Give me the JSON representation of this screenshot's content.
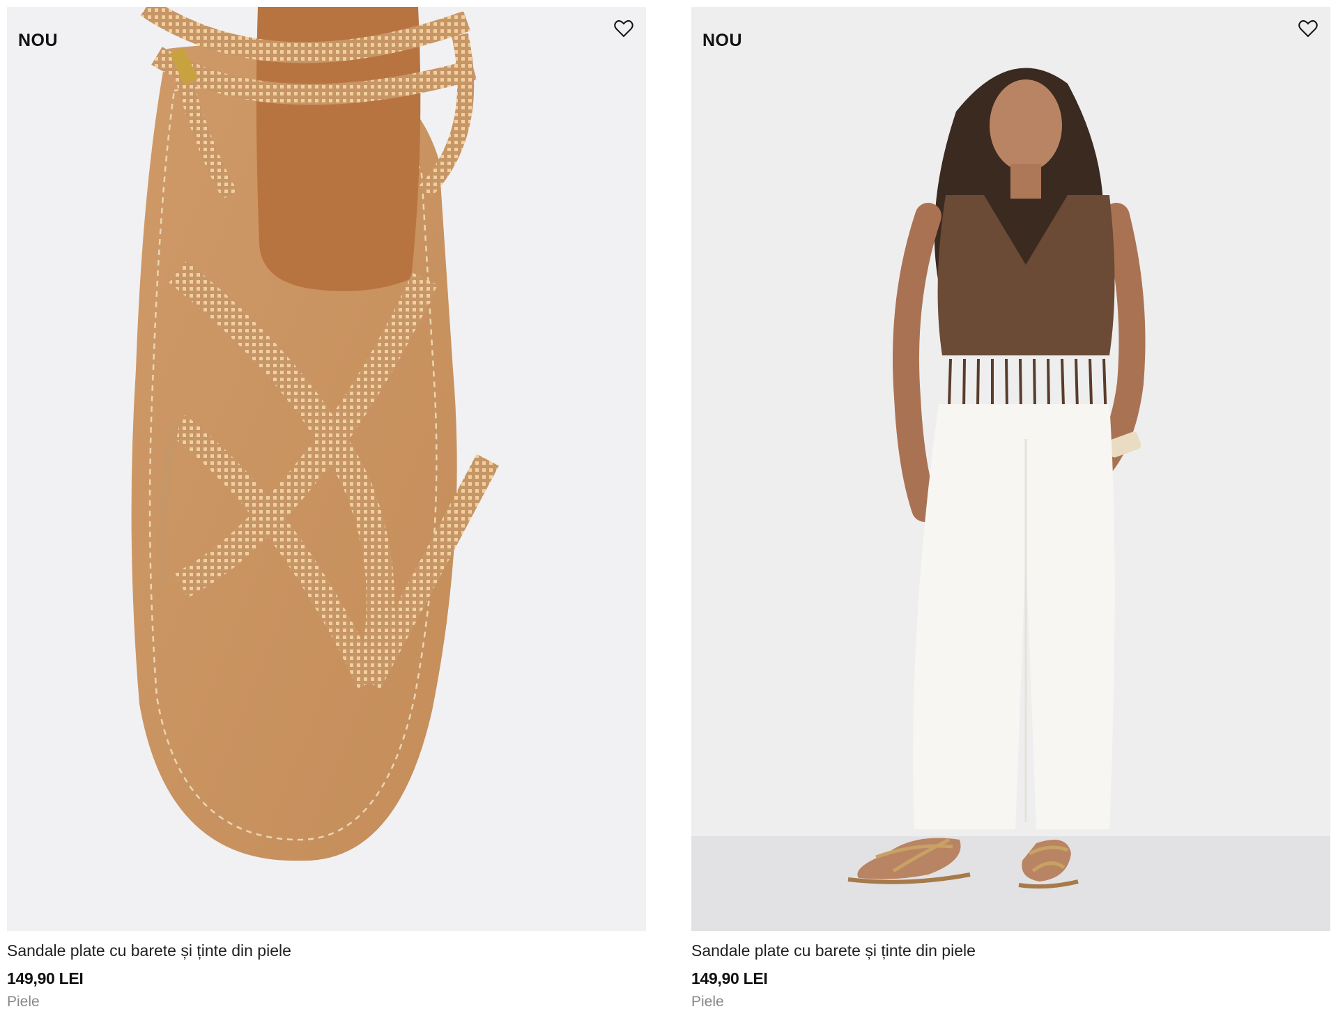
{
  "products": [
    {
      "badge": "NOU",
      "title": "Sandale plate cu barete și ținte din piele",
      "price": "149,90 LEI",
      "material": "Piele",
      "image_icon": "sandal-closeup-image",
      "favorite_icon": "heart-outline-icon"
    },
    {
      "badge": "NOU",
      "title": "Sandale plate cu barete și ținte din piele",
      "price": "149,90 LEI",
      "material": "Piele",
      "image_icon": "model-wearing-sandals-image",
      "favorite_icon": "heart-outline-icon"
    }
  ],
  "colors": {
    "image_bg": "#f1f1f3",
    "text": "#1a1a1a",
    "muted": "#888888",
    "sandal_tan": "#c9935f",
    "strap_gold": "#d8a878"
  }
}
